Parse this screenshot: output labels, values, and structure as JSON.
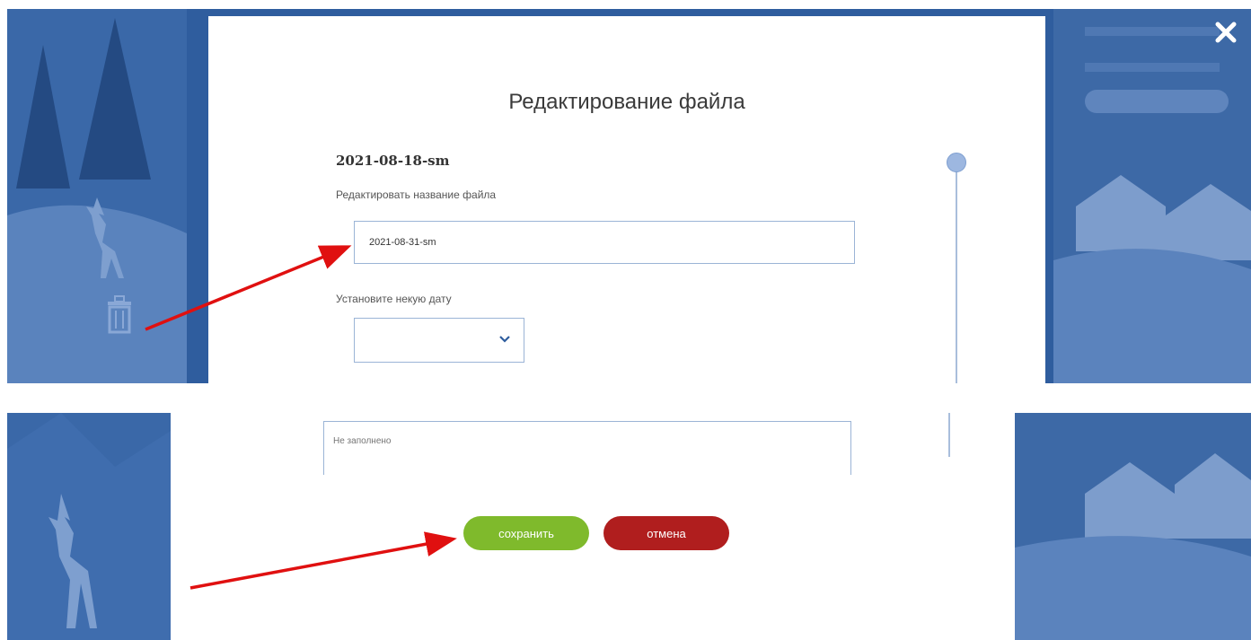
{
  "modal": {
    "title": "Редактирование файла",
    "file_name": "2021-08-18-sm",
    "edit_name_label": "Редактировать название файла",
    "name_input_value": "2021-08-31-sm",
    "date_label": "Установите некую дату",
    "description_placeholder": "Не заполнено",
    "save_label": "сохранить",
    "cancel_label": "отмена"
  },
  "colors": {
    "backdrop": "#2f5d9e",
    "save_button": "#7fba2c",
    "cancel_button": "#b01e1e",
    "annotation_arrow": "#e01010"
  },
  "icons": [
    "close-icon",
    "chevron-down-icon",
    "trash-icon",
    "deer-illustration"
  ]
}
